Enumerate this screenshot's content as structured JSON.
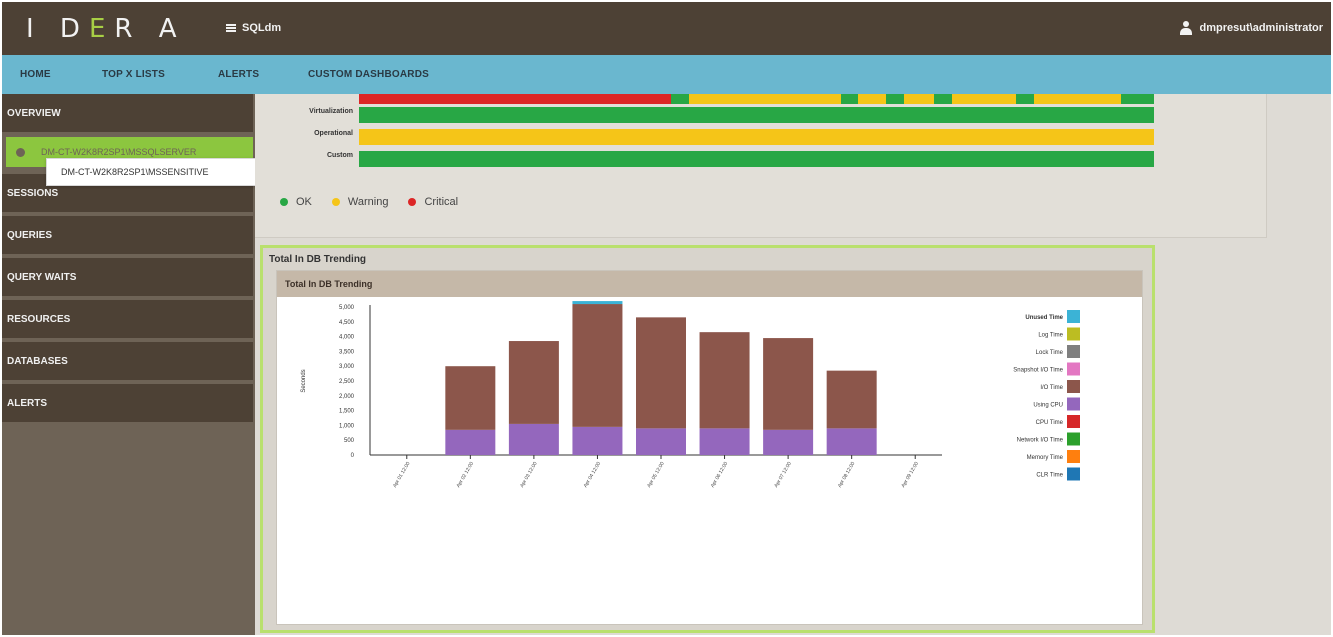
{
  "header": {
    "logo_text": "IDERA",
    "menu_label": "SQLdm",
    "user_label": "dmpresut\\administrator"
  },
  "nav": {
    "items": [
      "HOME",
      "TOP X LISTS",
      "ALERTS",
      "CUSTOM DASHBOARDS"
    ]
  },
  "sidebar": {
    "items": [
      "OVERVIEW",
      "SESSIONS",
      "QUERIES",
      "QUERY WAITS",
      "RESOURCES",
      "DATABASES",
      "ALERTS"
    ],
    "instance_label": "DM-CT-W2K8R2SP1\\MSSQLSERVER",
    "tooltip": "DM-CT-W2K8R2SP1\\MSSENSITIVE"
  },
  "status_rows": [
    {
      "label": "Virtualization",
      "color": "#28a745"
    },
    {
      "label": "Operational",
      "color": "#f5c518"
    },
    {
      "label": "Custom",
      "color": "#28a745"
    }
  ],
  "legend": {
    "items": [
      {
        "label": "OK",
        "color": "#28a745"
      },
      {
        "label": "Warning",
        "color": "#f5c518"
      },
      {
        "label": "Critical",
        "color": "#dc2626"
      }
    ]
  },
  "trending": {
    "outer_title": "Total In DB Trending",
    "panel_title": "Total In DB Trending"
  },
  "chart_data": {
    "type": "bar",
    "stacked": true,
    "xlabel": "",
    "ylabel": "Seconds",
    "ylim": [
      0,
      5000
    ],
    "yticks": [
      0,
      500,
      1000,
      1500,
      2000,
      2500,
      3000,
      3500,
      4000,
      4500,
      5000
    ],
    "ytick_labels": [
      "0",
      "500",
      "1,000",
      "1,500",
      "2,000",
      "2,500",
      "3,000",
      "3,500",
      "4,000",
      "4,500",
      "5,000"
    ],
    "categories": [
      "Apr 01 12:00",
      "Apr 02 12:00",
      "Apr 03 12:00",
      "Apr 04 12:00",
      "Apr 05 12:00",
      "Apr 06 12:00",
      "Apr 07 12:00",
      "Apr 08 12:00",
      "Apr 09 12:00"
    ],
    "series": [
      {
        "name": "Unused Time",
        "color": "#3bb3d6",
        "values": [
          0,
          0,
          0,
          100,
          0,
          0,
          0,
          0,
          0
        ]
      },
      {
        "name": "Log Time",
        "color": "#bcbd22",
        "values": [
          0,
          0,
          0,
          0,
          0,
          0,
          0,
          0,
          0
        ]
      },
      {
        "name": "Lock Time",
        "color": "#7f7f7f",
        "values": [
          0,
          0,
          0,
          0,
          0,
          0,
          0,
          0,
          0
        ]
      },
      {
        "name": "Snapshot I/O Time",
        "color": "#e377c2",
        "values": [
          0,
          0,
          0,
          0,
          0,
          0,
          0,
          0,
          0
        ]
      },
      {
        "name": "I/O Time",
        "color": "#8c564b",
        "values": [
          0,
          2150,
          2800,
          4150,
          3750,
          3250,
          3100,
          1950,
          0
        ]
      },
      {
        "name": "Using CPU",
        "color": "#9467bd",
        "values": [
          0,
          850,
          1050,
          950,
          900,
          900,
          850,
          900,
          0
        ]
      },
      {
        "name": "CPU Time",
        "color": "#d62728",
        "values": [
          0,
          0,
          0,
          0,
          0,
          0,
          0,
          0,
          0
        ]
      },
      {
        "name": "Network I/O Time",
        "color": "#2ca02c",
        "values": [
          0,
          0,
          0,
          0,
          0,
          0,
          0,
          0,
          0
        ]
      },
      {
        "name": "Memory Time",
        "color": "#ff7f0e",
        "values": [
          0,
          0,
          0,
          0,
          0,
          0,
          0,
          0,
          0
        ]
      },
      {
        "name": "CLR Time",
        "color": "#1f77b4",
        "values": [
          0,
          0,
          0,
          0,
          0,
          0,
          0,
          0,
          0
        ]
      }
    ]
  }
}
